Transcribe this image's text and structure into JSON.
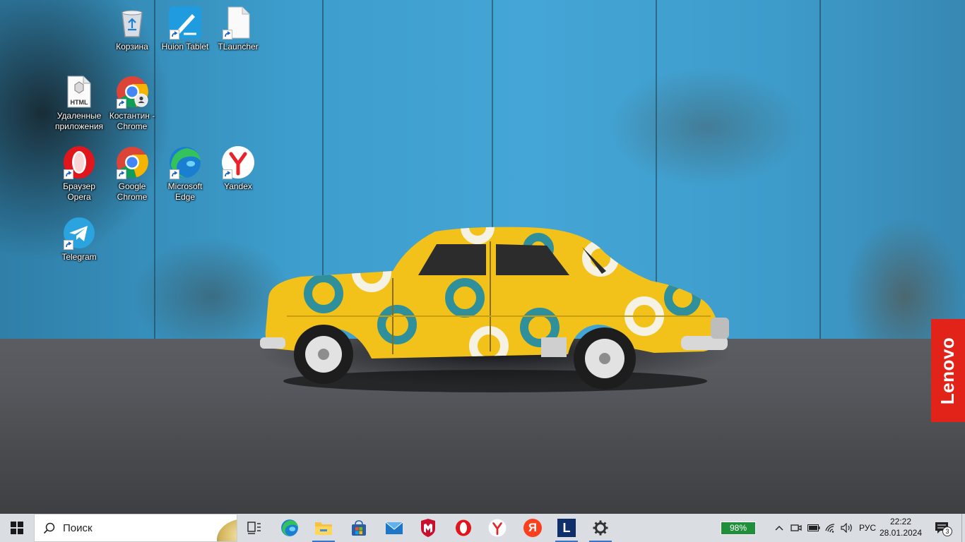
{
  "desktop": {
    "icons": [
      {
        "id": "recycle",
        "label": "Корзина"
      },
      {
        "id": "huion",
        "label": "Huion Tablet"
      },
      {
        "id": "tlauncher",
        "label": "TLauncher"
      },
      {
        "id": "removed-apps",
        "label": "Удаленные приложения"
      },
      {
        "id": "chrome-profile",
        "label": "Костантин - Chrome"
      },
      {
        "id": "opera",
        "label": "Браузер Opera"
      },
      {
        "id": "google-chrome",
        "label": "Google Chrome"
      },
      {
        "id": "edge",
        "label": "Microsoft Edge"
      },
      {
        "id": "yandex",
        "label": "Yandex"
      },
      {
        "id": "telegram",
        "label": "Telegram"
      }
    ],
    "html_file_badge": "HTML",
    "brand_tab": "Lenovo"
  },
  "taskbar": {
    "search_placeholder": "Поиск",
    "apps": [
      {
        "name": "task-view",
        "icon": "task-view-icon"
      },
      {
        "name": "edge",
        "icon": "edge-icon"
      },
      {
        "name": "file-explorer",
        "icon": "folder-icon"
      },
      {
        "name": "microsoft-store",
        "icon": "store-icon"
      },
      {
        "name": "mail",
        "icon": "mail-icon"
      },
      {
        "name": "mcafee",
        "icon": "mcafee-icon"
      },
      {
        "name": "opera",
        "icon": "opera-icon"
      },
      {
        "name": "yandex-browser",
        "icon": "yandex-icon"
      },
      {
        "name": "yandex",
        "icon": "ya-icon"
      },
      {
        "name": "l-app",
        "icon": "l-app-icon"
      },
      {
        "name": "settings",
        "icon": "gear-icon"
      }
    ],
    "yandex_letter": "Я",
    "l_letter": "L",
    "battery_percent": "98%",
    "language": "РУС",
    "time": "22:22",
    "date": "28.01.2024",
    "notifications_count": "3"
  },
  "colors": {
    "taskbar_bg": "#dadee3",
    "accent": "#3a74c4",
    "battery_badge": "#1f8f3c",
    "lenovo_red": "#e2231a",
    "car_yellow": "#f2c21a",
    "car_pattern": "#2f8f9a"
  }
}
